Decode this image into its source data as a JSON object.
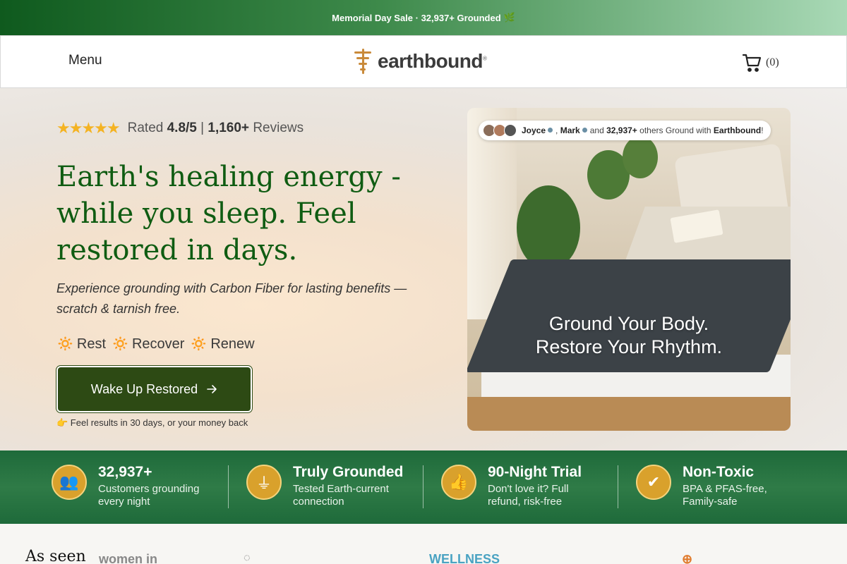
{
  "announcement": {
    "text": "Memorial Day Sale · 32,937+ Grounded",
    "emoji": "🌿"
  },
  "header": {
    "menu_label": "Menu",
    "logo_text": "earthbound",
    "logo_mark": "®",
    "cart_count": "(0)"
  },
  "hero": {
    "rating_prefix": "Rated",
    "rating_value": "4.8/5",
    "rating_sep": "|",
    "review_count": "1,160+",
    "review_label": "Reviews",
    "headline": "Earth's healing energy - while you sleep. Feel restored in days.",
    "subline": "Experience grounding with Carbon Fiber for lasting benefits — scratch & tarnish free.",
    "pillars": [
      "Rest",
      "Recover",
      "Renew"
    ],
    "cta_label": "Wake Up Restored",
    "guarantee": "👉 Feel results in 30 days, or your money back"
  },
  "hero_image": {
    "social_names_1": "Joyce",
    "social_names_2": "Mark",
    "social_mid": "and",
    "social_count": "32,937+",
    "social_suffix": "others Ground with",
    "social_brand": "Earthbound",
    "social_end": "!",
    "caption_line1": "Ground Your Body.",
    "caption_line2": "Restore Your Rhythm."
  },
  "trust": [
    {
      "title": "32,937+",
      "line1": "Customers grounding",
      "line2": "every night",
      "icon": "people-icon"
    },
    {
      "title": "Truly Grounded",
      "line1": "Tested Earth-current",
      "line2": "connection",
      "icon": "ground-icon"
    },
    {
      "title": "90-Night Trial",
      "line1": "Don't love it? Full",
      "line2": "refund, risk-free",
      "icon": "thumbs-up-icon"
    },
    {
      "title": "Non-Toxic",
      "line1": "BPA & PFAS-free,",
      "line2": "Family-safe",
      "icon": "check-shield-icon"
    }
  ],
  "as_seen": {
    "label": "As seen",
    "press": [
      "women in",
      "WELLNESS"
    ]
  },
  "colors": {
    "brand_green": "#0f5c12",
    "cta_green": "#2d4a14",
    "trust_green": "#1e6a3a",
    "star_gold": "#f4b323",
    "badge_gold": "#d9a12c"
  }
}
